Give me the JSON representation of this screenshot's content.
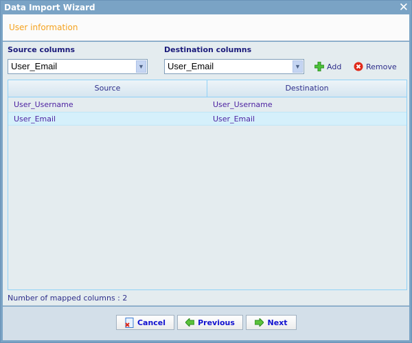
{
  "window": {
    "title": "Data Import Wizard",
    "close_icon": "close-icon"
  },
  "header": {
    "title": "User information"
  },
  "source": {
    "label": "Source columns",
    "selected": "User_Email"
  },
  "destination": {
    "label": "Destination columns",
    "selected": "User_Email"
  },
  "actions": {
    "add": "Add",
    "remove": "Remove"
  },
  "grid": {
    "columns": [
      "Source",
      "Destination"
    ],
    "rows": [
      [
        "User_Username",
        "User_Username"
      ],
      [
        "User_Email",
        "User_Email"
      ]
    ]
  },
  "status": {
    "count_text": "Number of mapped columns : 2"
  },
  "buttons": {
    "cancel": "Cancel",
    "previous": "Previous",
    "next": "Next"
  },
  "colors": {
    "accent": "#f5a21e",
    "titlebar": "#7aa3c5",
    "selected_row": "#d5f0fb"
  }
}
